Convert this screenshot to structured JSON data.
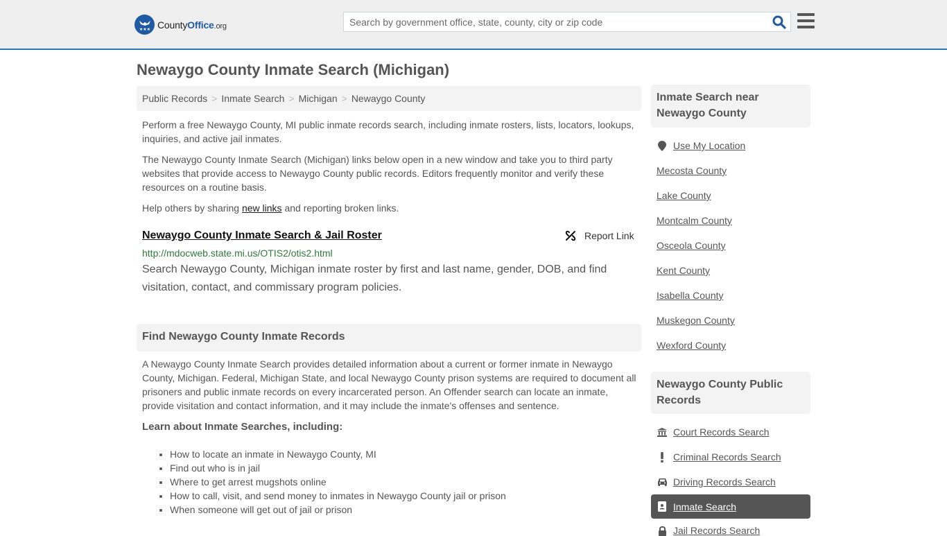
{
  "header": {
    "logo": {
      "part1": "County",
      "part2": "Office",
      "tld": ".org"
    },
    "search_placeholder": "Search by government office, state, county, city or zip code",
    "search_value": "",
    "icons": {
      "search": "search-icon",
      "menu": "hamburger-menu-icon"
    }
  },
  "page": {
    "title": "Newaygo County Inmate Search (Michigan)",
    "breadcrumb": [
      "Public Records",
      "Inmate Search",
      "Michigan",
      "Newaygo County"
    ],
    "breadcrumb_separator": ">",
    "intro": "Perform a free Newaygo County, MI public inmate records search, including inmate rosters, lists, locators, lookups, inquiries, and active jail inmates.",
    "disclaimer": "The Newaygo County Inmate Search (Michigan) links below open in a new window and take you to third party websites that provide access to Newaygo County public records. Editors frequently monitor and verify these resources on a routine basis.",
    "help": {
      "before": "Help others by sharing ",
      "link": "new links",
      "after": " and reporting broken links."
    }
  },
  "results": [
    {
      "title": "Newaygo County Inmate Search & Jail Roster",
      "url": "http://mdocweb.state.mi.us/OTIS2/otis2.html",
      "description": "Search Newaygo County, Michigan inmate roster by first and last name, gender, DOB, and find visitation, contact, and commissary program policies.",
      "report_label": "Report Link"
    }
  ],
  "find_section": {
    "heading": "Find Newaygo County Inmate Records",
    "body": "A Newaygo County Inmate Search provides detailed information about a current or former inmate in Newaygo County, Michigan. Federal, Michigan State, and local Newaygo County prison systems are required to document all prisoners and public inmate records on every incarcerated person. An Offender search can locate an inmate, provide visitation and contact information, and it may include the inmate's offenses and sentence.",
    "learn_heading": "Learn about Inmate Searches, including:",
    "learn_items": [
      "How to locate an inmate in Newaygo County, MI",
      "Find out who is in jail",
      "Where to get arrest mugshots online",
      "How to call, visit, and send money to inmates in Newaygo County jail or prison",
      "When someone will get out of jail or prison"
    ]
  },
  "sidebar": {
    "nearby": {
      "heading": "Inmate Search near Newaygo County",
      "use_location": "Use My Location",
      "counties": [
        "Mecosta County",
        "Lake County",
        "Montcalm County",
        "Osceola County",
        "Kent County",
        "Isabella County",
        "Muskegon County",
        "Wexford County"
      ]
    },
    "public_records": {
      "heading": "Newaygo County Public Records",
      "items": [
        {
          "label": "Court Records Search",
          "icon": "courthouse-icon",
          "active": false
        },
        {
          "label": "Criminal Records Search",
          "icon": "exclamation-icon",
          "active": false
        },
        {
          "label": "Driving Records Search",
          "icon": "car-icon",
          "active": false
        },
        {
          "label": "Inmate Search",
          "icon": "id-badge-icon",
          "active": true
        },
        {
          "label": "Jail Records Search",
          "icon": "lock-icon",
          "active": false
        }
      ]
    }
  },
  "colors": {
    "brand_blue": "#1f5aa3",
    "header_border": "#2e75b0",
    "url_green": "#2f7a3a",
    "active_item_bg": "#555555"
  }
}
